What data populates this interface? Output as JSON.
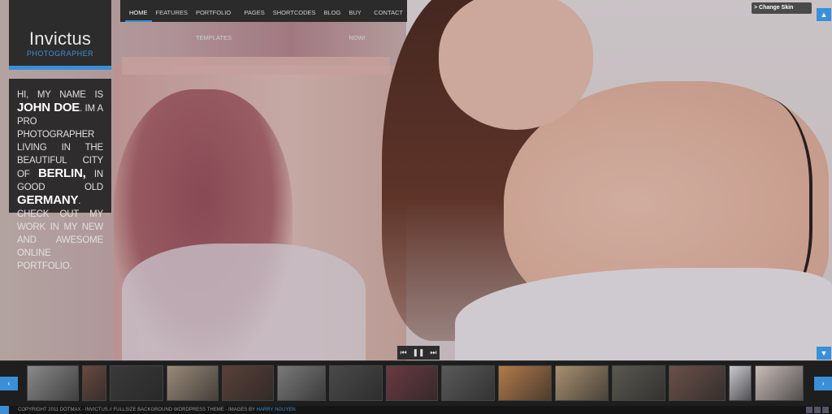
{
  "logo": {
    "name": "Invictus",
    "tagline": "PHOTOGRAPHER"
  },
  "nav": {
    "items": [
      "HOME",
      "FEATURES",
      "PORTFOLIO TEMPLATES",
      "PAGES",
      "SHORTCODES",
      "BLOG",
      "BUY NOW!",
      "CONTACT"
    ],
    "active": "HOME"
  },
  "intro": {
    "hi": "HI, MY NAME IS",
    "name": "JOHN DOE",
    "mid": ". IM A PRO PHOTOGRAPHER LIVING IN THE BEAUTIFUL CITY OF",
    "city": "BERLIN,",
    "mid2": "IN GOOD OLD",
    "country": "GERMANY",
    "end": ". CHECK OUT MY WORK IN MY NEW AND AWESOME ONLINE PORTFOLIO."
  },
  "skin": {
    "label": "> Change Skin"
  },
  "scroll": {
    "up": "up-arrow-icon",
    "down": "down-arrow-icon"
  },
  "player": {
    "prev": "⏮",
    "pause": "❚❚",
    "next": "⏭"
  },
  "strip": {
    "prev_icon": "‹",
    "next_icon": "›",
    "thumbs": [
      {
        "w": 64,
        "color": "#8a8a8a"
      },
      {
        "w": 30,
        "color": "#6a4a40"
      },
      {
        "w": 66,
        "color": "#3a3a3a"
      },
      {
        "w": 64,
        "color": "#9a8a78"
      },
      {
        "w": 64,
        "color": "#5a4038"
      },
      {
        "w": 60,
        "color": "#7a7a7a"
      },
      {
        "w": 66,
        "color": "#4a4a4a"
      },
      {
        "w": 64,
        "color": "#6a3a42"
      },
      {
        "w": 66,
        "color": "#5a5a5a"
      },
      {
        "w": 66,
        "color": "#b27a4a"
      },
      {
        "w": 66,
        "color": "#a89070"
      },
      {
        "w": 66,
        "color": "#5a5850"
      },
      {
        "w": 70,
        "color": "#6a5048"
      },
      {
        "w": 28,
        "color": "#c8c8d0"
      },
      {
        "w": 60,
        "color": "#c8bcb8"
      }
    ]
  },
  "footer": {
    "copy": "COPYRIGHT 2011 DOTMAX - INVICTUS // FULLSIZE BACKGROUND WORDPRESS THEME - IMAGES BY",
    "credit": "HARRY NGUYEN"
  },
  "colors": {
    "accent": "#3a8fd9",
    "panel": "#2c2c2c"
  }
}
